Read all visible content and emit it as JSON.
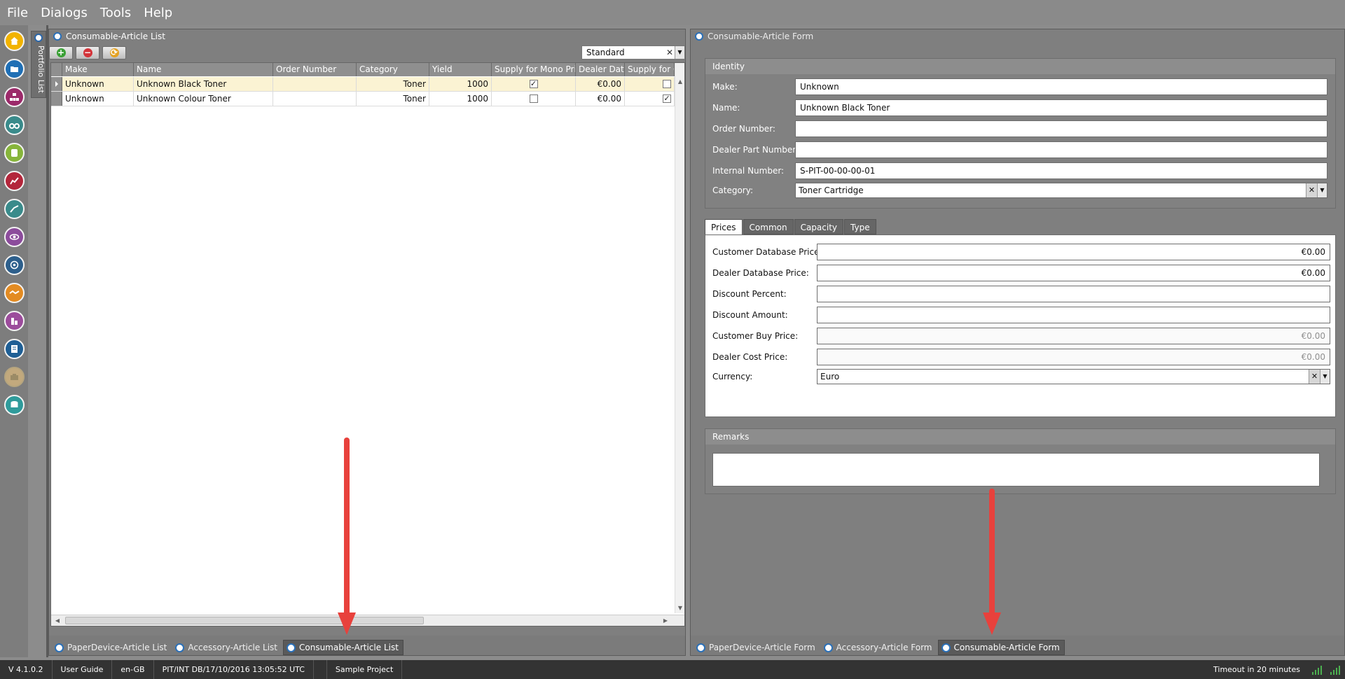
{
  "menu": [
    "File",
    "Dialogs",
    "Tools",
    "Help"
  ],
  "side_nav": [
    {
      "name": "home-icon",
      "color": "#f2b300"
    },
    {
      "name": "folder-icon",
      "color": "#1f6fb5"
    },
    {
      "name": "hierarchy-icon",
      "color": "#9c2a6a"
    },
    {
      "name": "binoculars-icon",
      "color": "#3a8b8b"
    },
    {
      "name": "scroll-icon",
      "color": "#87b53b"
    },
    {
      "name": "chart-icon",
      "color": "#b3263b"
    },
    {
      "name": "trend-icon",
      "color": "#3a8b8b"
    },
    {
      "name": "eye-icon",
      "color": "#8c4c9c"
    },
    {
      "name": "target-icon",
      "color": "#2d5f8c"
    },
    {
      "name": "handshake-icon",
      "color": "#e38b22"
    },
    {
      "name": "bars-icon",
      "color": "#9c4c9c"
    },
    {
      "name": "document-icon",
      "color": "#1f5f95"
    },
    {
      "name": "briefcase-icon",
      "color": "#c2a97d"
    },
    {
      "name": "database-icon",
      "color": "#2f9b9b"
    }
  ],
  "portfolio_list_label": "Portfolio List",
  "list_panel": {
    "title": "Consumable-Article List",
    "layout_value": "Standard",
    "columns": [
      "Make",
      "Name",
      "Order Number",
      "Category",
      "Yield",
      "Supply for Mono Pri",
      "Dealer Dat",
      "Supply for C"
    ],
    "rows": [
      {
        "make": "Unknown",
        "name": "Unknown Black Toner",
        "order_number": "",
        "category": "Toner",
        "yield": "1000",
        "mono": "✓",
        "dealer": "€0.00",
        "colour": ""
      },
      {
        "make": "Unknown",
        "name": "Unknown Colour Toner",
        "order_number": "",
        "category": "Toner",
        "yield": "1000",
        "mono": "",
        "dealer": "€0.00",
        "colour": "✓"
      }
    ],
    "tabs": [
      "PaperDevice-Article List",
      "Accessory-Article List",
      "Consumable-Article List"
    ]
  },
  "form_panel": {
    "title": "Consumable-Article Form",
    "identity": {
      "group_title": "Identity",
      "make_label": "Make:",
      "make_value": "Unknown",
      "name_label": "Name:",
      "name_value": "Unknown Black Toner",
      "order_label": "Order Number:",
      "order_value": "",
      "dealer_part_label": "Dealer Part Number:",
      "dealer_part_value": "",
      "internal_label": "Internal Number:",
      "internal_value": "S-PIT-00-00-00-01",
      "category_label": "Category:",
      "category_value": "Toner Cartridge"
    },
    "tabs": [
      "Prices",
      "Common",
      "Capacity",
      "Type"
    ],
    "prices": {
      "customer_db_label": "Customer Database Price:",
      "customer_db_value": "€0.00",
      "dealer_db_label": "Dealer Database Price:",
      "dealer_db_value": "€0.00",
      "discount_pct_label": "Discount Percent:",
      "discount_pct_value": "",
      "discount_amt_label": "Discount Amount:",
      "discount_amt_value": "",
      "customer_buy_label": "Customer Buy Price:",
      "customer_buy_value": "€0.00",
      "dealer_cost_label": "Dealer Cost Price:",
      "dealer_cost_value": "€0.00",
      "currency_label": "Currency:",
      "currency_value": "Euro"
    },
    "remarks_title": "Remarks",
    "remarks_value": "",
    "tabs_bottom": [
      "PaperDevice-Article Form",
      "Accessory-Article Form",
      "Consumable-Article Form"
    ]
  },
  "status": {
    "version": "V 4.1.0.2",
    "user_guide": "User Guide",
    "locale": "en-GB",
    "db": "PIT/INT DB/17/10/2016 13:05:52 UTC",
    "project": "Sample Project",
    "timeout": "Timeout in 20 minutes"
  },
  "colors": {
    "arrow": "#e8413c",
    "selected_row": "#fbf3d3",
    "accent": "#2b70b8"
  }
}
